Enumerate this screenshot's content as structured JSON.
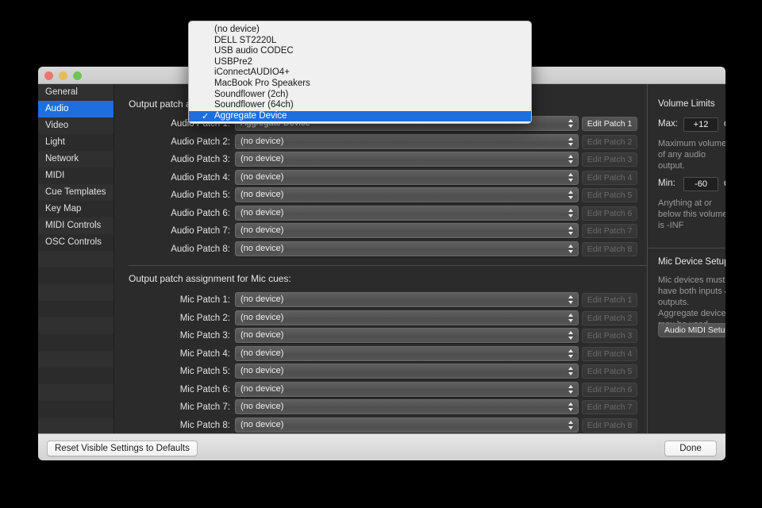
{
  "window": {
    "title": "",
    "traffic_lights": [
      "close",
      "minimize",
      "zoom"
    ]
  },
  "sidebar": {
    "items": [
      {
        "label": "General",
        "selected": false
      },
      {
        "label": "Audio",
        "selected": true
      },
      {
        "label": "Video",
        "selected": false
      },
      {
        "label": "Light",
        "selected": false
      },
      {
        "label": "Network",
        "selected": false
      },
      {
        "label": "MIDI",
        "selected": false
      },
      {
        "label": "Cue Templates",
        "selected": false
      },
      {
        "label": "Key Map",
        "selected": false
      },
      {
        "label": "MIDI Controls",
        "selected": false
      },
      {
        "label": "OSC Controls",
        "selected": false
      }
    ]
  },
  "audio_section": {
    "heading": "Output patch assignment for Audio cues:",
    "rows": [
      {
        "label": "Audio Patch 1:",
        "value": "Aggregate Device",
        "button": "Edit Patch 1",
        "button_enabled": true
      },
      {
        "label": "Audio Patch 2:",
        "value": "(no device)",
        "button": "Edit Patch 2",
        "button_enabled": false
      },
      {
        "label": "Audio Patch 3:",
        "value": "(no device)",
        "button": "Edit Patch 3",
        "button_enabled": false
      },
      {
        "label": "Audio Patch 4:",
        "value": "(no device)",
        "button": "Edit Patch 4",
        "button_enabled": false
      },
      {
        "label": "Audio Patch 5:",
        "value": "(no device)",
        "button": "Edit Patch 5",
        "button_enabled": false
      },
      {
        "label": "Audio Patch 6:",
        "value": "(no device)",
        "button": "Edit Patch 6",
        "button_enabled": false
      },
      {
        "label": "Audio Patch 7:",
        "value": "(no device)",
        "button": "Edit Patch 7",
        "button_enabled": false
      },
      {
        "label": "Audio Patch 8:",
        "value": "(no device)",
        "button": "Edit Patch 8",
        "button_enabled": false
      }
    ]
  },
  "mic_section": {
    "heading": "Output patch assignment for Mic cues:",
    "rows": [
      {
        "label": "Mic Patch 1:",
        "value": "(no device)",
        "button": "Edit Patch 1",
        "button_enabled": false
      },
      {
        "label": "Mic Patch 2:",
        "value": "(no device)",
        "button": "Edit Patch 2",
        "button_enabled": false
      },
      {
        "label": "Mic Patch 3:",
        "value": "(no device)",
        "button": "Edit Patch 3",
        "button_enabled": false
      },
      {
        "label": "Mic Patch 4:",
        "value": "(no device)",
        "button": "Edit Patch 4",
        "button_enabled": false
      },
      {
        "label": "Mic Patch 5:",
        "value": "(no device)",
        "button": "Edit Patch 5",
        "button_enabled": false
      },
      {
        "label": "Mic Patch 6:",
        "value": "(no device)",
        "button": "Edit Patch 6",
        "button_enabled": false
      },
      {
        "label": "Mic Patch 7:",
        "value": "(no device)",
        "button": "Edit Patch 7",
        "button_enabled": false
      },
      {
        "label": "Mic Patch 8:",
        "value": "(no device)",
        "button": "Edit Patch 8",
        "button_enabled": false
      }
    ]
  },
  "volume_limits": {
    "title": "Volume Limits",
    "max_label": "Max:",
    "max_value": "+12",
    "max_unit": "dB",
    "max_help": "Maximum volume of any audio output.",
    "min_label": "Min:",
    "min_value": "-60",
    "min_unit": "dB",
    "min_help": "Anything at or below this volume is -INF"
  },
  "mic_device_setup": {
    "title": "Mic Device Setup",
    "help": "Mic devices must have both inputs & outputs. Aggregate devices may be used.",
    "button": "Audio MIDI Setup..."
  },
  "footer": {
    "reset_label": "Reset Visible Settings to Defaults",
    "done_label": "Done"
  },
  "dropdown": {
    "check_glyph": "✓",
    "items": [
      {
        "label": "(no device)",
        "selected": false
      },
      {
        "label": "DELL ST2220L",
        "selected": false
      },
      {
        "label": "USB audio CODEC",
        "selected": false
      },
      {
        "label": "USBPre2",
        "selected": false
      },
      {
        "label": "iConnectAUDIO4+",
        "selected": false
      },
      {
        "label": "MacBook Pro Speakers",
        "selected": false
      },
      {
        "label": "Soundflower (2ch)",
        "selected": false
      },
      {
        "label": "Soundflower (64ch)",
        "selected": false
      },
      {
        "label": "Aggregate Device",
        "selected": true
      }
    ]
  },
  "colors": {
    "accent": "#1d6fe0",
    "window_bg": "#2b2b2b",
    "sidebar_bg": "#2e2e2e",
    "popup_bg": "#f0f0f0",
    "desktop_bg": "#000000"
  }
}
